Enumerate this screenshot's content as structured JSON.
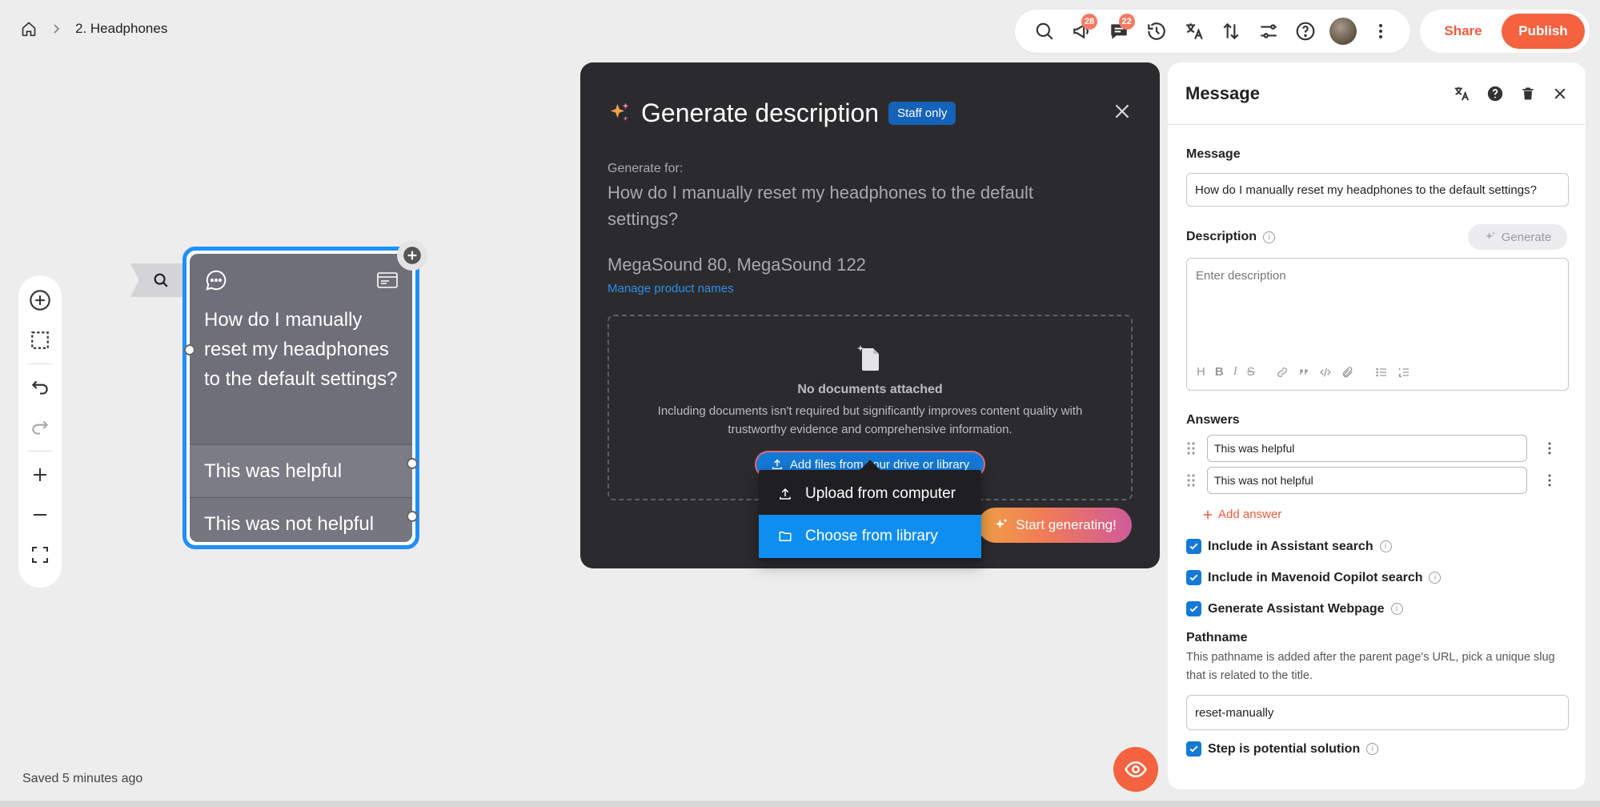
{
  "breadcrumb": {
    "page": "2. Headphones"
  },
  "toolbar": {
    "announce_badge": "28",
    "comments_badge": "22"
  },
  "actions": {
    "share": "Share",
    "publish": "Publish"
  },
  "status": {
    "saved": "Saved 5 minutes ago"
  },
  "node": {
    "question": "How do I manually reset my headphones to the default settings?",
    "answers": [
      "This was helpful",
      "This was not helpful"
    ]
  },
  "modal": {
    "title": "Generate description",
    "badge": "Staff only",
    "generate_for_label": "Generate for:",
    "question": "How do I manually reset my headphones to the default settings?",
    "products": "MegaSound 80, MegaSound 122",
    "manage_link": "Manage product names",
    "drop_title": "No documents attached",
    "drop_sub": "Including documents isn't required but significantly improves content quality with trustworthy evidence and comprehensive information.",
    "add_files": "Add files from your drive or library",
    "start": "Start generating!",
    "menu": [
      "Upload from computer",
      "Choose from library"
    ]
  },
  "panel": {
    "title": "Message",
    "message_label": "Message",
    "message_value": "How do I manually reset my headphones to the default settings?",
    "description_label": "Description",
    "generate": "Generate",
    "description_placeholder": "Enter description",
    "rte": [
      "H",
      "B",
      "I",
      "S"
    ],
    "answers_label": "Answers",
    "answers": [
      "This was helpful",
      "This was not helpful"
    ],
    "add_answer": "Add answer",
    "checks": [
      "Include in Assistant search",
      "Include in Mavenoid Copilot search",
      "Generate Assistant Webpage"
    ],
    "pathname_label": "Pathname",
    "pathname_help": "This pathname is added after the parent page's URL, pick a unique slug that is related to the title.",
    "pathname_value": "reset-manually",
    "potential_solution": "Step is potential solution"
  },
  "colors": {
    "accent": "#f4623f",
    "blue": "#1479d6",
    "modal_bg": "#2b2b2e",
    "node_border": "#1e90ff"
  }
}
